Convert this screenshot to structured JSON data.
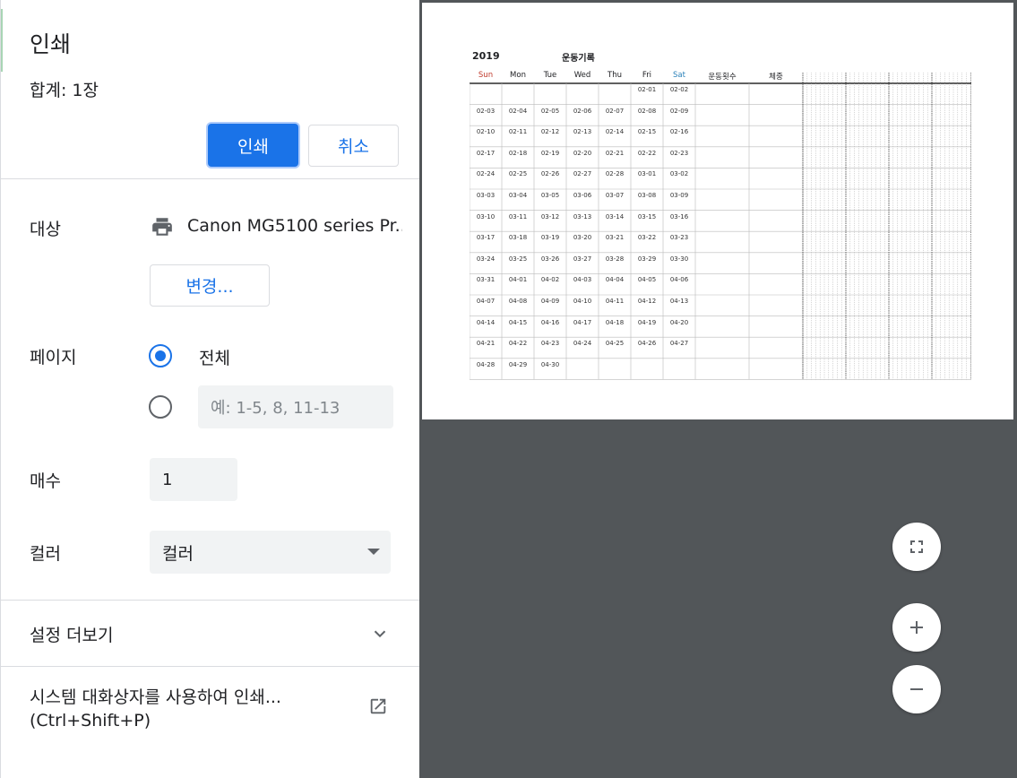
{
  "header": {
    "title": "인쇄",
    "total": "합계: 1장"
  },
  "actions": {
    "print_label": "인쇄",
    "cancel_label": "취소"
  },
  "destination": {
    "label": "대상",
    "printer_name": "Canon MG5100 series Pr...",
    "change_label": "변경..."
  },
  "pages": {
    "label": "페이지",
    "all_label": "전체",
    "custom_placeholder": "예: 1-5, 8, 11-13"
  },
  "copies": {
    "label": "매수",
    "value": "1"
  },
  "color": {
    "label": "컬러",
    "selected": "컬러"
  },
  "more_settings": {
    "label": "설정 더보기"
  },
  "system_dialog": {
    "label": "시스템 대화상자를 사용하여 인쇄...",
    "shortcut": "(Ctrl+Shift+P)"
  },
  "preview": {
    "year": "2019",
    "title": "운동기록",
    "headers": [
      "Sun",
      "Mon",
      "Tue",
      "Wed",
      "Thu",
      "Fri",
      "Sat",
      "운동횟수",
      "체중"
    ],
    "header_colors": {
      "sun": "#c0392b",
      "sat": "#2980b9"
    },
    "rows": [
      [
        "",
        "",
        "",
        "",
        "",
        "02-01",
        "02-02"
      ],
      [
        "02-03",
        "02-04",
        "02-05",
        "02-06",
        "02-07",
        "02-08",
        "02-09"
      ],
      [
        "02-10",
        "02-11",
        "02-12",
        "02-13",
        "02-14",
        "02-15",
        "02-16"
      ],
      [
        "02-17",
        "02-18",
        "02-19",
        "02-20",
        "02-21",
        "02-22",
        "02-23"
      ],
      [
        "02-24",
        "02-25",
        "02-26",
        "02-27",
        "02-28",
        "03-01",
        "03-02"
      ],
      [
        "03-03",
        "03-04",
        "03-05",
        "03-06",
        "03-07",
        "03-08",
        "03-09"
      ],
      [
        "03-10",
        "03-11",
        "03-12",
        "03-13",
        "03-14",
        "03-15",
        "03-16"
      ],
      [
        "03-17",
        "03-18",
        "03-19",
        "03-20",
        "03-21",
        "03-22",
        "03-23"
      ],
      [
        "03-24",
        "03-25",
        "03-26",
        "03-27",
        "03-28",
        "03-29",
        "03-30"
      ],
      [
        "03-31",
        "04-01",
        "04-02",
        "04-03",
        "04-04",
        "04-05",
        "04-06"
      ],
      [
        "04-07",
        "04-08",
        "04-09",
        "04-10",
        "04-11",
        "04-12",
        "04-13"
      ],
      [
        "04-14",
        "04-15",
        "04-16",
        "04-17",
        "04-18",
        "04-19",
        "04-20"
      ],
      [
        "04-21",
        "04-22",
        "04-23",
        "04-24",
        "04-25",
        "04-26",
        "04-27"
      ],
      [
        "04-28",
        "04-29",
        "04-30",
        "",
        "",
        "",
        ""
      ]
    ]
  },
  "controls": {
    "fit_icon": "fullscreen-icon",
    "zoom_in_icon": "plus-icon",
    "zoom_out_icon": "minus-icon"
  },
  "theme": {
    "accent": "#1a73e8",
    "preview_bg": "#525659"
  }
}
